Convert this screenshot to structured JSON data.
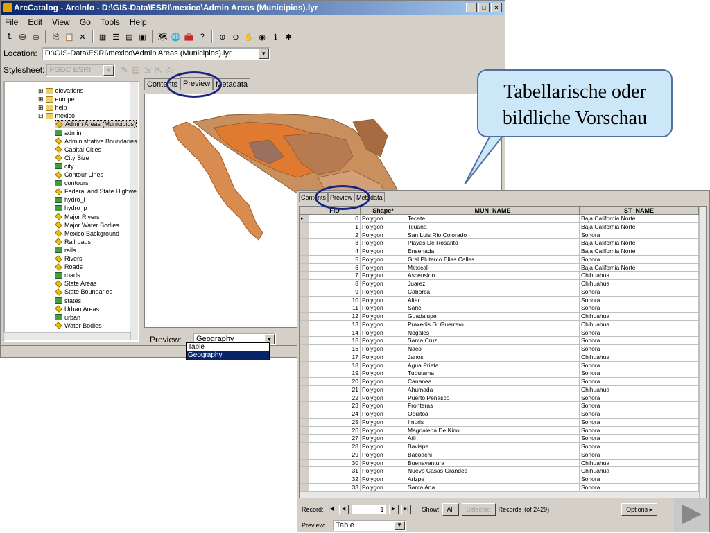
{
  "window": {
    "title": "ArcCatalog - ArcInfo - D:\\GIS-Data\\ESRI\\mexico\\Admin Areas (Municipios).lyr",
    "controls": [
      "_",
      "□",
      "×"
    ]
  },
  "menu": [
    "File",
    "Edit",
    "View",
    "Go",
    "Tools",
    "Help"
  ],
  "location": {
    "label": "Location:",
    "value": "D:\\GIS-Data\\ESRI\\mexico\\Admin Areas (Municipios).lyr"
  },
  "stylesheet": {
    "label": "Stylesheet:",
    "value": "FGDC ESRI"
  },
  "tree": {
    "items": [
      {
        "label": "elevations",
        "icon": "folder-icon",
        "level": 1
      },
      {
        "label": "europe",
        "icon": "folder-icon",
        "level": 1
      },
      {
        "label": "help",
        "icon": "folder-icon",
        "level": 1
      },
      {
        "label": "mexico",
        "icon": "folder-icon",
        "level": 1
      },
      {
        "label": "Admin Areas (Municipios)",
        "icon": "layer-icon",
        "level": 2,
        "selected": true
      },
      {
        "label": "admin",
        "icon": "shapefile-icon",
        "level": 2
      },
      {
        "label": "Administrative Boundaries",
        "icon": "layer-icon",
        "level": 2
      },
      {
        "label": "Capital Cities",
        "icon": "layer-icon",
        "level": 2
      },
      {
        "label": "City Size",
        "icon": "layer-icon",
        "level": 2
      },
      {
        "label": "city",
        "icon": "shapefile-icon",
        "level": 2
      },
      {
        "label": "Contour Lines",
        "icon": "layer-icon",
        "level": 2
      },
      {
        "label": "contours",
        "icon": "shapefile-icon",
        "level": 2
      },
      {
        "label": "Federal and State Highwe",
        "icon": "layer-icon",
        "level": 2
      },
      {
        "label": "hydro_l",
        "icon": "shapefile-icon",
        "level": 2
      },
      {
        "label": "hydro_p",
        "icon": "shapefile-icon",
        "level": 2
      },
      {
        "label": "Major Rivers",
        "icon": "layer-icon",
        "level": 2
      },
      {
        "label": "Major Water Bodies",
        "icon": "layer-icon",
        "level": 2
      },
      {
        "label": "Mexico Background",
        "icon": "layer-icon",
        "level": 2
      },
      {
        "label": "Railroads",
        "icon": "layer-icon",
        "level": 2
      },
      {
        "label": "rails",
        "icon": "shapefile-icon",
        "level": 2
      },
      {
        "label": "Rivers",
        "icon": "layer-icon",
        "level": 2
      },
      {
        "label": "Roads",
        "icon": "layer-icon",
        "level": 2
      },
      {
        "label": "roads",
        "icon": "shapefile-icon",
        "level": 2
      },
      {
        "label": "State Areas",
        "icon": "layer-icon",
        "level": 2
      },
      {
        "label": "State Boundaries",
        "icon": "layer-icon",
        "level": 2
      },
      {
        "label": "states",
        "icon": "shapefile-icon",
        "level": 2
      },
      {
        "label": "Urban Areas",
        "icon": "layer-icon",
        "level": 2
      },
      {
        "label": "urban",
        "icon": "shapefile-icon",
        "level": 2
      },
      {
        "label": "Water Bodies",
        "icon": "layer-icon",
        "level": 2
      }
    ]
  },
  "tabs": [
    "Contents",
    "Preview",
    "Metadata"
  ],
  "preview": {
    "label": "Preview:",
    "value": "Geography",
    "options": [
      "Table",
      "Geography"
    ]
  },
  "table": {
    "tabs": [
      "Contents",
      "Preview",
      "Metadata"
    ],
    "columns": [
      "FID",
      "Shape*",
      "MUN_NAME",
      "ST_NAME"
    ],
    "rows": [
      [
        "0",
        "Polygon",
        "Tecate",
        "Baja California Norte"
      ],
      [
        "1",
        "Polygon",
        "Tijuana",
        "Baja California Norte"
      ],
      [
        "2",
        "Polygon",
        "San Luis Rio Colorado",
        "Sonora"
      ],
      [
        "3",
        "Polygon",
        "Playas De Rosarito",
        "Baja California Norte"
      ],
      [
        "4",
        "Polygon",
        "Ensenada",
        "Baja California Norte"
      ],
      [
        "5",
        "Polygon",
        "Gral Plutarco Elias Calles",
        "Sonora"
      ],
      [
        "6",
        "Polygon",
        "Mexicali",
        "Baja California Norte"
      ],
      [
        "7",
        "Polygon",
        "Ascension",
        "Chihuahua"
      ],
      [
        "8",
        "Polygon",
        "Juarez",
        "Chihuahua"
      ],
      [
        "9",
        "Polygon",
        "Caborca",
        "Sonora"
      ],
      [
        "10",
        "Polygon",
        "Altar",
        "Sonora"
      ],
      [
        "11",
        "Polygon",
        "Saric",
        "Sonora"
      ],
      [
        "12",
        "Polygon",
        "Guadalupe",
        "Chihuahua"
      ],
      [
        "13",
        "Polygon",
        "Praxedis G. Guerrero",
        "Chihuahua"
      ],
      [
        "14",
        "Polygon",
        "Nogales",
        "Sonora"
      ],
      [
        "15",
        "Polygon",
        "Santa Cruz",
        "Sonora"
      ],
      [
        "16",
        "Polygon",
        "Naco",
        "Sonora"
      ],
      [
        "17",
        "Polygon",
        "Janos",
        "Chihuahua"
      ],
      [
        "18",
        "Polygon",
        "Agua Prieta",
        "Sonora"
      ],
      [
        "19",
        "Polygon",
        "Tubutama",
        "Sonora"
      ],
      [
        "20",
        "Polygon",
        "Cananea",
        "Sonora"
      ],
      [
        "21",
        "Polygon",
        "Ahumada",
        "Chihuahua"
      ],
      [
        "22",
        "Polygon",
        "Puerto Peñasco",
        "Sonora"
      ],
      [
        "23",
        "Polygon",
        "Fronteras",
        "Sonora"
      ],
      [
        "24",
        "Polygon",
        "Oquitoa",
        "Sonora"
      ],
      [
        "25",
        "Polygon",
        "Imuris",
        "Sonora"
      ],
      [
        "26",
        "Polygon",
        "Magdalena De Kino",
        "Sonora"
      ],
      [
        "27",
        "Polygon",
        "Atil",
        "Sonora"
      ],
      [
        "28",
        "Polygon",
        "Bavispe",
        "Sonora"
      ],
      [
        "29",
        "Polygon",
        "Bacoachi",
        "Sonora"
      ],
      [
        "30",
        "Polygon",
        "Buenaventura",
        "Chihuahua"
      ],
      [
        "31",
        "Polygon",
        "Nuevo Casas Grandes",
        "Chihuahua"
      ],
      [
        "32",
        "Polygon",
        "Arizpe",
        "Sonora"
      ],
      [
        "33",
        "Polygon",
        "Santa Ana",
        "Sonora"
      ]
    ],
    "record_label": "Record:",
    "record_value": "1",
    "show_label": "Show:",
    "all_label": "All",
    "selected_label": "Selected",
    "records_label": "Records",
    "records_count": "(of 2429)",
    "options_label": "Options",
    "preview_label": "Preview:",
    "preview_value": "Table"
  },
  "callout": {
    "line1": "Tabellarische oder",
    "line2": "bildliche Vorschau"
  },
  "colors": {
    "titlebar": "#0a246a",
    "highlight": "#1a237e",
    "callout": "#cce8f8"
  }
}
